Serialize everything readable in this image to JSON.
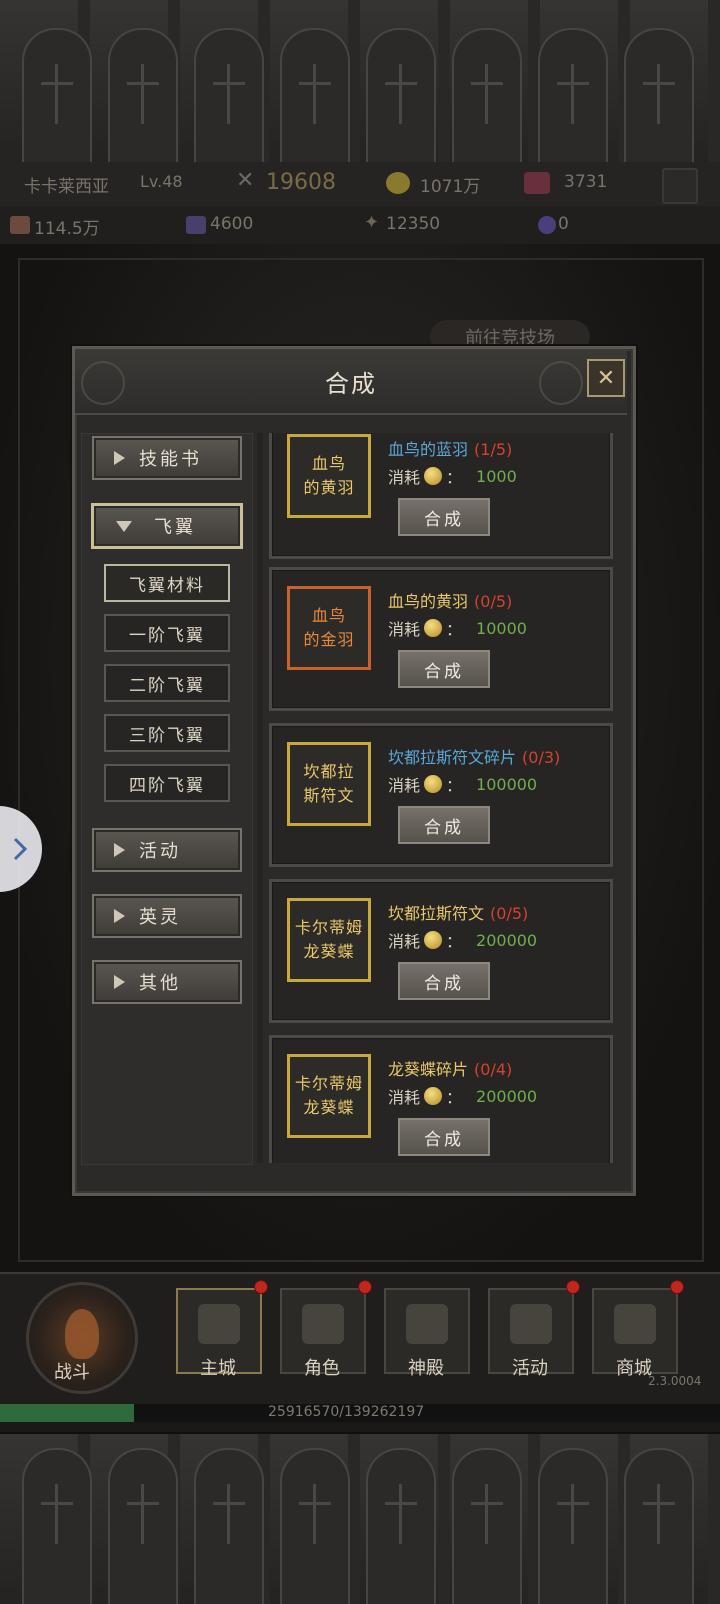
{
  "player": {
    "name": "卡卡莱西亚",
    "level": "Lv.48",
    "power": "19608",
    "gold": "1071万",
    "gems": "3731"
  },
  "resources": {
    "r1": "114.5万",
    "r2": "4600",
    "r3": "12350",
    "r4": "0"
  },
  "backdrop": {
    "arena_tag": "前往竞技场"
  },
  "dialog": {
    "title": "合成",
    "close_label": "✕",
    "categories": {
      "skill_book": "技能书",
      "wings": "飞翼",
      "activity": "活动",
      "hero_spirit": "英灵",
      "other": "其他"
    },
    "wing_subtabs": [
      "飞翼材料",
      "一阶飞翼",
      "二阶飞翼",
      "三阶飞翼",
      "四阶飞翼"
    ],
    "cost_label": "消耗",
    "colon": "：",
    "craft_label": "合成",
    "recipes": [
      {
        "box": [
          "血鸟",
          "的黄羽"
        ],
        "box_color": "gold",
        "target": "血鸟的蓝羽",
        "target_color": "blue",
        "count": "(1/5)",
        "cost": "1000"
      },
      {
        "box": [
          "血鸟",
          "的金羽"
        ],
        "box_color": "orange",
        "target": "血鸟的黄羽",
        "target_color": "gold",
        "count": "(0/5)",
        "cost": "10000"
      },
      {
        "box": [
          "坎都拉",
          "斯符文"
        ],
        "box_color": "gold",
        "target": "坎都拉斯符文碎片",
        "target_color": "blue",
        "count": "(0/3)",
        "cost": "100000"
      },
      {
        "box": [
          "卡尔蒂姆",
          "龙葵蝶"
        ],
        "box_color": "gold",
        "target": "坎都拉斯符文",
        "target_color": "gold",
        "count": "(0/5)",
        "cost": "200000"
      },
      {
        "box": [
          "卡尔蒂姆",
          "龙葵蝶"
        ],
        "box_color": "gold",
        "target": "龙葵蝶碎片",
        "target_color": "gold",
        "count": "(0/4)",
        "cost": "200000"
      }
    ]
  },
  "nav": {
    "fight": "战斗",
    "tabs": [
      "主城",
      "角色",
      "神殿",
      "活动",
      "商城"
    ],
    "version": "2.3.0004",
    "xp_text": "25916570/139262197",
    "xp_fraction": 0.186
  }
}
